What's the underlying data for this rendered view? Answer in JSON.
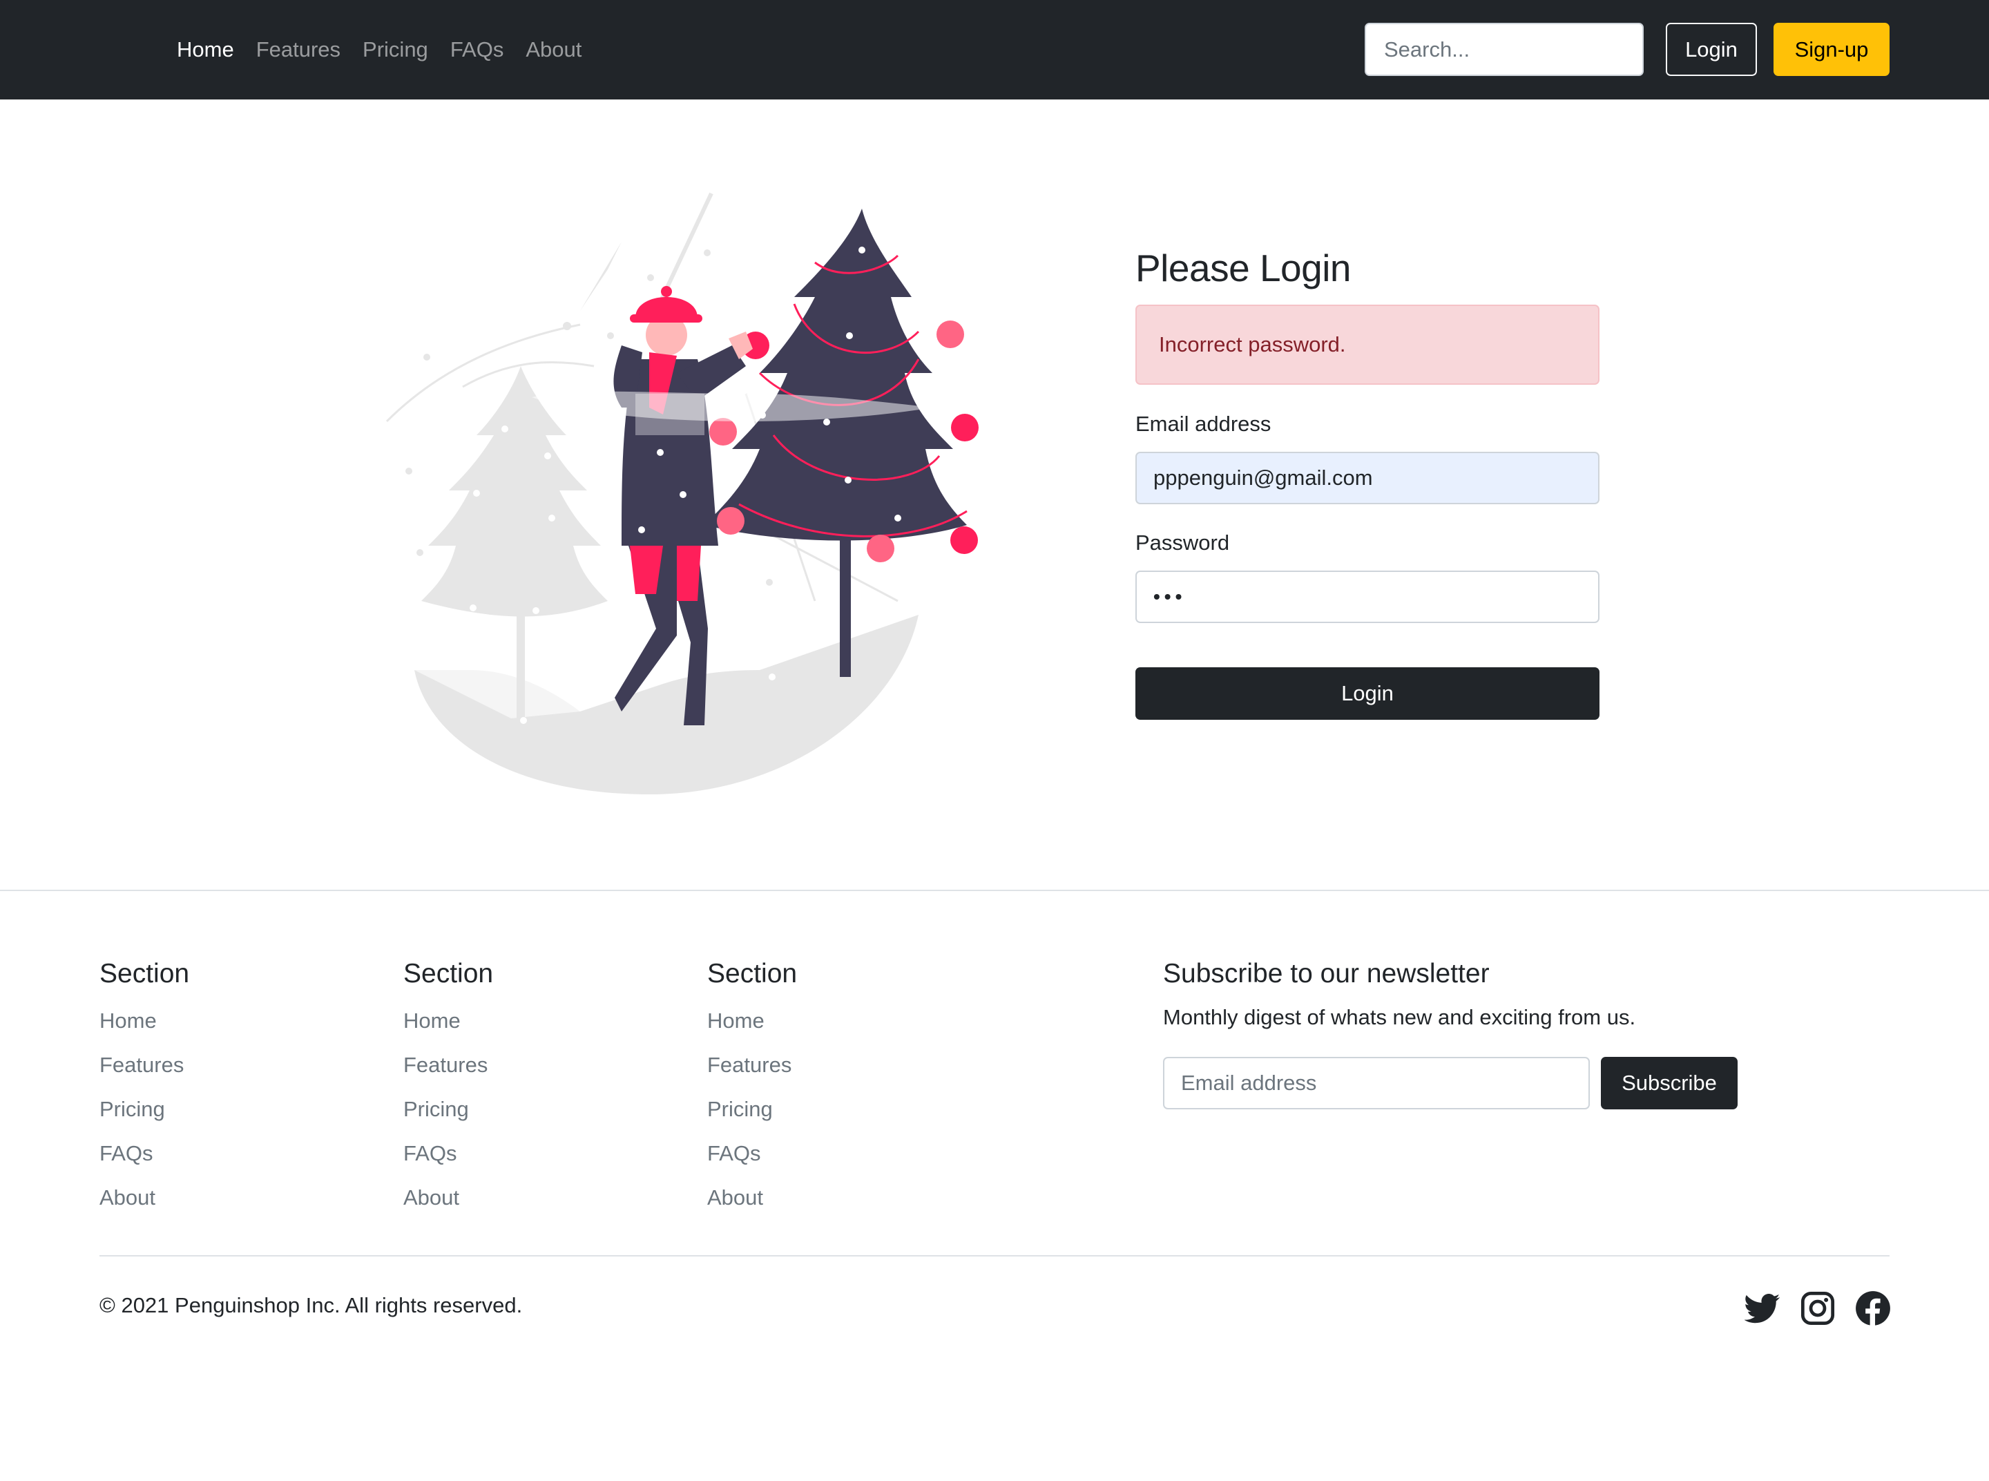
{
  "navbar": {
    "links": [
      {
        "label": "Home",
        "active": true
      },
      {
        "label": "Features",
        "active": false
      },
      {
        "label": "Pricing",
        "active": false
      },
      {
        "label": "FAQs",
        "active": false
      },
      {
        "label": "About",
        "active": false
      }
    ],
    "search_placeholder": "Search...",
    "login_label": "Login",
    "signup_label": "Sign-up"
  },
  "login": {
    "title": "Please Login",
    "alert": "Incorrect password.",
    "email_label": "Email address",
    "email_value": "pppenguin@gmail.com",
    "password_label": "Password",
    "password_mask": "•••",
    "submit_label": "Login",
    "illustration": "woman-decorating-christmas-tree"
  },
  "footer": {
    "sections": [
      {
        "title": "Section",
        "links": [
          "Home",
          "Features",
          "Pricing",
          "FAQs",
          "About"
        ]
      },
      {
        "title": "Section",
        "links": [
          "Home",
          "Features",
          "Pricing",
          "FAQs",
          "About"
        ]
      },
      {
        "title": "Section",
        "links": [
          "Home",
          "Features",
          "Pricing",
          "FAQs",
          "About"
        ]
      }
    ],
    "newsletter": {
      "title": "Subscribe to our newsletter",
      "description": "Monthly digest of whats new and exciting from us.",
      "email_placeholder": "Email address",
      "subscribe_label": "Subscribe"
    },
    "copyright": "© 2021 Penguinshop Inc. All rights reserved.",
    "social_icons": [
      "twitter-icon",
      "instagram-icon",
      "facebook-icon"
    ]
  },
  "colors": {
    "navbar_bg": "#212529",
    "accent_yellow": "#ffc107",
    "alert_bg": "#f8d7da",
    "alert_text": "#842029",
    "illustration_pink": "#ff1f5a",
    "illustration_dark": "#3f3d56",
    "illustration_gray": "#e6e6e6"
  }
}
